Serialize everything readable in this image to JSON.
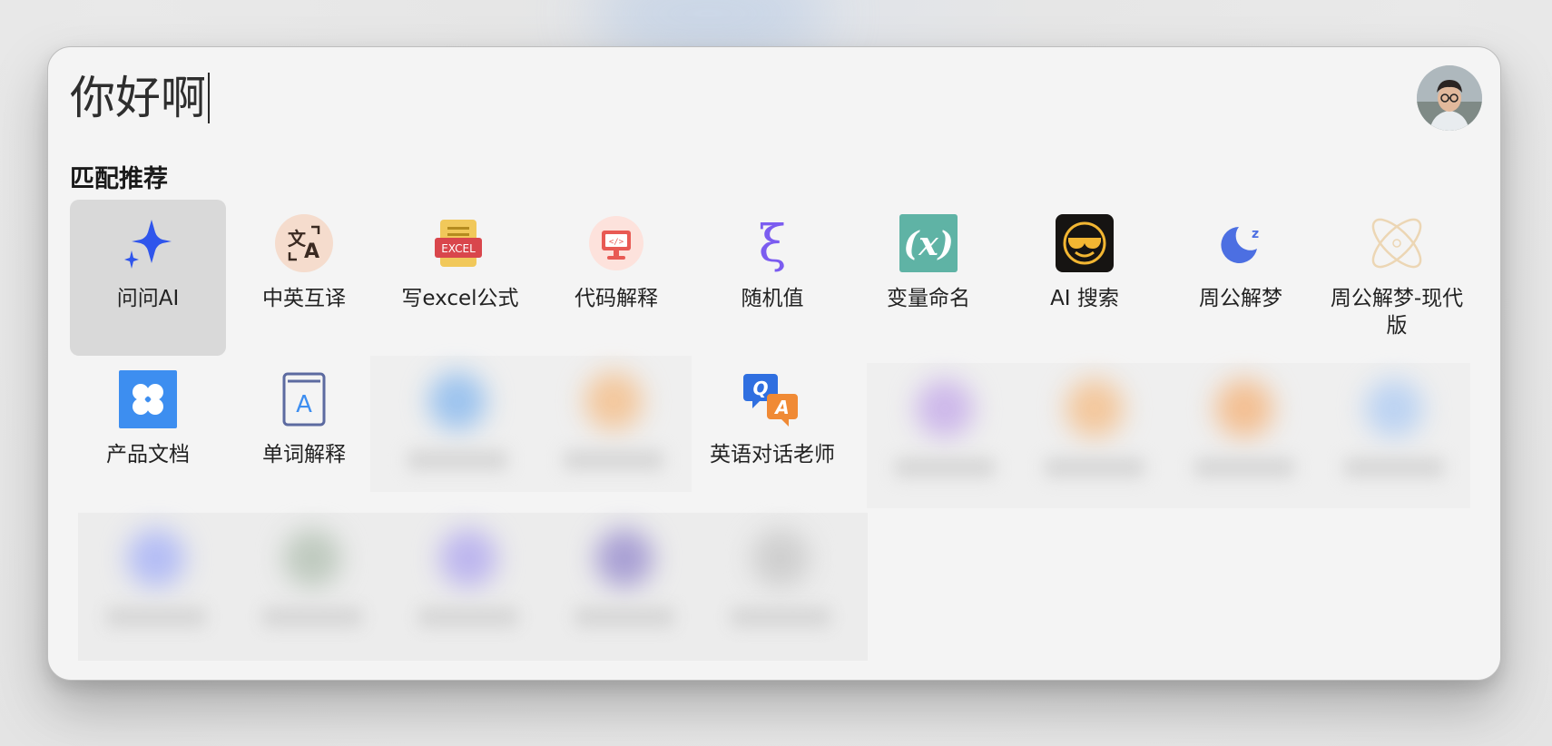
{
  "search": {
    "query": "你好啊"
  },
  "section": {
    "title": "匹配推荐"
  },
  "apps": [
    {
      "label": "问问AI",
      "icon": "sparkle-icon"
    },
    {
      "label": "中英互译",
      "icon": "translate-icon"
    },
    {
      "label": "写excel公式",
      "icon": "excel-icon"
    },
    {
      "label": "代码解释",
      "icon": "code-monitor-icon"
    },
    {
      "label": "随机值",
      "icon": "xi-icon"
    },
    {
      "label": "变量命名",
      "icon": "variable-x-icon"
    },
    {
      "label": "AI 搜索",
      "icon": "sunglasses-emoji-icon"
    },
    {
      "label": "周公解梦",
      "icon": "moon-zzz-icon"
    },
    {
      "label": "周公解梦-现代版",
      "icon": "planet-icon"
    },
    {
      "label": "产品文档",
      "icon": "clover-icon"
    },
    {
      "label": "单词解释",
      "icon": "dictionary-icon"
    },
    {
      "label": "英语对话老师",
      "icon": "qa-bubbles-icon"
    }
  ],
  "colors": {
    "accent_blue": "#3b5bf0",
    "selected_bg": "#d9d9d9",
    "window_bg": "#f4f4f4"
  }
}
